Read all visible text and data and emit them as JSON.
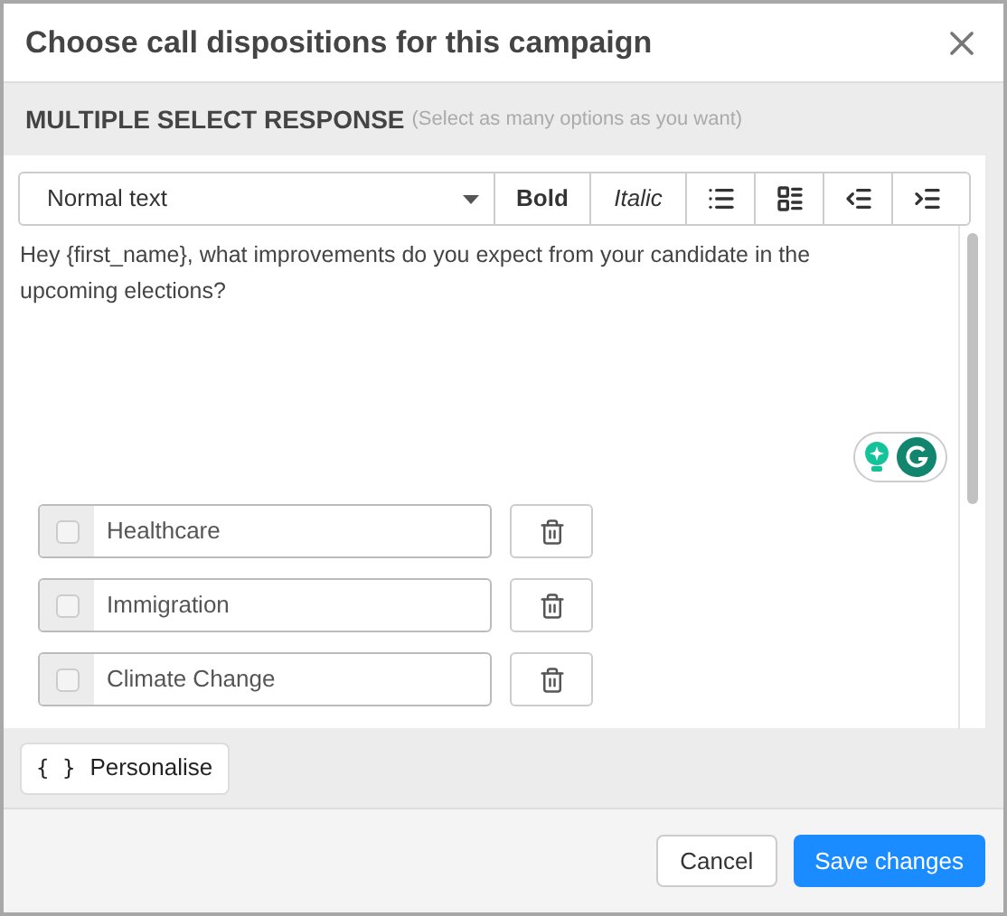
{
  "dialog": {
    "title": "Choose call dispositions for this campaign"
  },
  "section": {
    "title": "MULTIPLE SELECT RESPONSE",
    "hint": "(Select as many options as you want)"
  },
  "toolbar": {
    "style_select": "Normal text",
    "buttons": [
      {
        "kind": "bold",
        "label": "Bold"
      },
      {
        "kind": "italic",
        "label": "Italic"
      },
      {
        "kind": "bullet-list"
      },
      {
        "kind": "block-list"
      },
      {
        "kind": "outdent"
      },
      {
        "kind": "indent"
      }
    ]
  },
  "editor": {
    "text": "Hey {first_name}, what improvements do you expect from your candidate in the upcoming elections?"
  },
  "options": [
    {
      "label": "Healthcare",
      "checked": false
    },
    {
      "label": "Immigration",
      "checked": false
    },
    {
      "label": "Climate Change",
      "checked": false
    }
  ],
  "personalise": {
    "icon": "{ }",
    "label": "Personalise"
  },
  "footer": {
    "buttons": [
      {
        "kind": "secondary",
        "label": "Cancel"
      },
      {
        "kind": "primary",
        "label": "Save changes"
      }
    ]
  }
}
